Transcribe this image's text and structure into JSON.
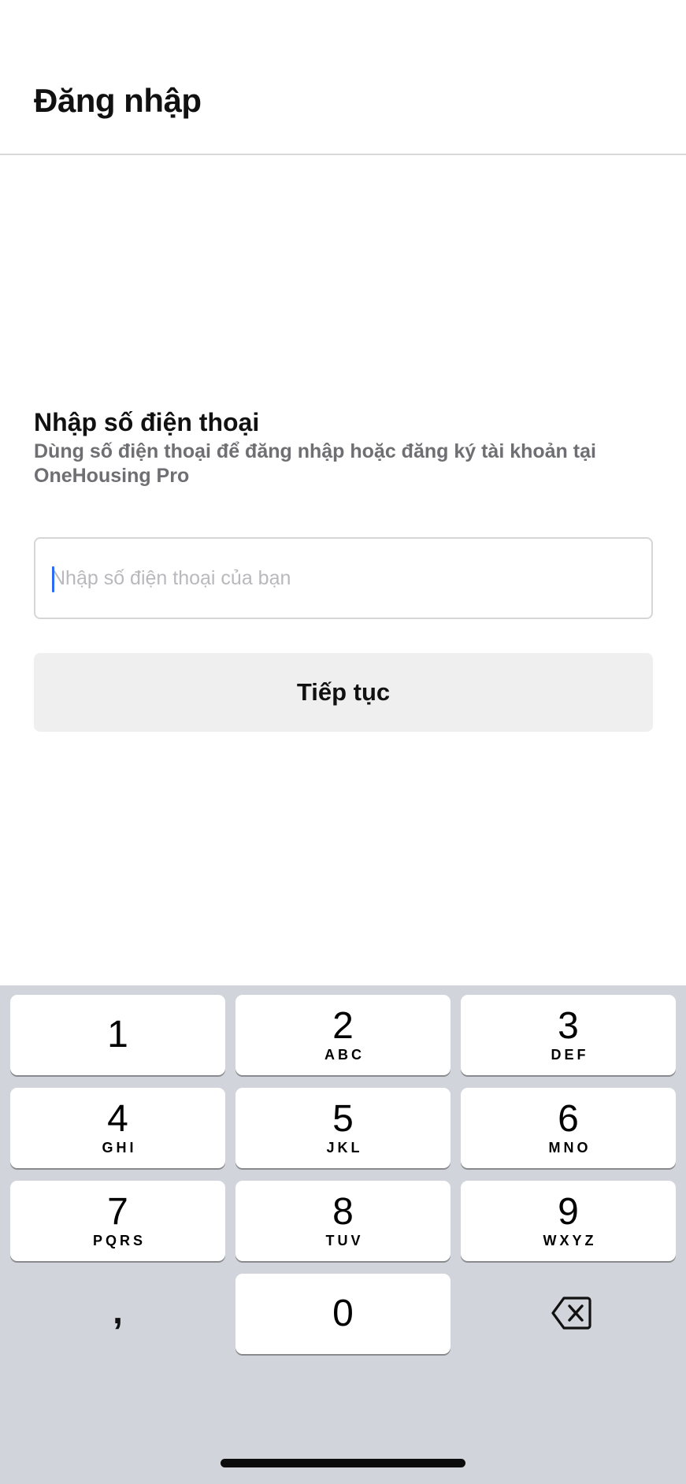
{
  "header": {
    "title": "Đăng nhập"
  },
  "login": {
    "section_title": "Nhập số điện thoại",
    "description": "Dùng số điện thoại để đăng nhập hoặc đăng ký tài khoản tại OneHousing Pro",
    "phone_input": {
      "value": "",
      "placeholder": "Nhập số điện thoại của bạn"
    },
    "continue_label": "Tiếp tục"
  },
  "keyboard": {
    "keys": [
      {
        "digit": "1",
        "letters": ""
      },
      {
        "digit": "2",
        "letters": "ABC"
      },
      {
        "digit": "3",
        "letters": "DEF"
      },
      {
        "digit": "4",
        "letters": "GHI"
      },
      {
        "digit": "5",
        "letters": "JKL"
      },
      {
        "digit": "6",
        "letters": "MNO"
      },
      {
        "digit": "7",
        "letters": "PQRS"
      },
      {
        "digit": "8",
        "letters": "TUV"
      },
      {
        "digit": "9",
        "letters": "WXYZ"
      }
    ],
    "comma_label": ",",
    "zero_label": "0",
    "backspace_icon": "delete-left-icon"
  },
  "colors": {
    "caret": "#2c6bf2",
    "keyboard_bg": "#d1d4da",
    "button_bg": "#efefef"
  }
}
